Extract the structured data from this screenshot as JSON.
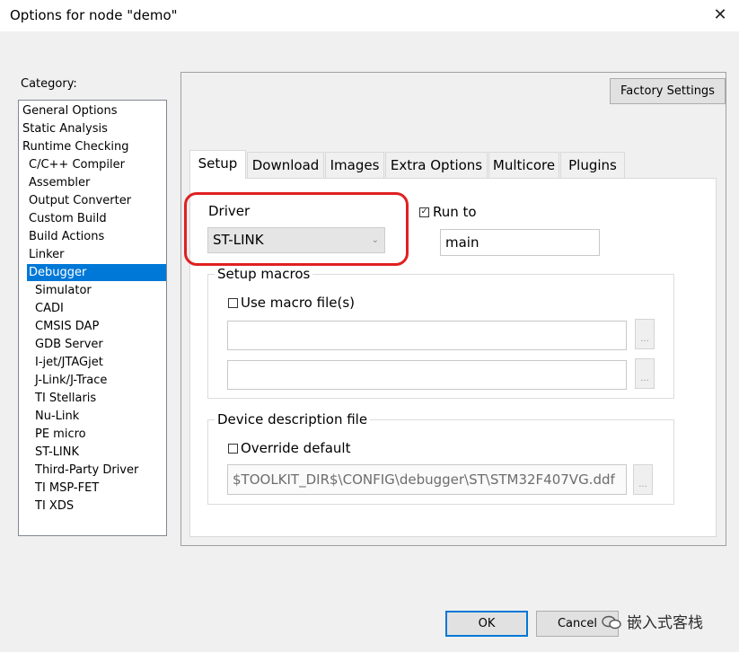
{
  "window": {
    "title": "Options for node \"demo\"",
    "close_glyph": "✕"
  },
  "category": {
    "label": "Category:",
    "items": [
      {
        "label": "General Options"
      },
      {
        "label": "Static Analysis"
      },
      {
        "label": "Runtime Checking"
      },
      {
        "label": "C/C++ Compiler"
      },
      {
        "label": "Assembler"
      },
      {
        "label": "Output Converter"
      },
      {
        "label": "Custom Build"
      },
      {
        "label": "Build Actions"
      },
      {
        "label": "Linker"
      },
      {
        "label": "Debugger",
        "selected": true
      },
      {
        "label": "Simulator"
      },
      {
        "label": "CADI"
      },
      {
        "label": "CMSIS DAP"
      },
      {
        "label": "GDB Server"
      },
      {
        "label": "I-jet/JTAGjet"
      },
      {
        "label": "J-Link/J-Trace"
      },
      {
        "label": "TI Stellaris"
      },
      {
        "label": "Nu-Link"
      },
      {
        "label": "PE micro"
      },
      {
        "label": "ST-LINK"
      },
      {
        "label": "Third-Party Driver"
      },
      {
        "label": "TI MSP-FET"
      },
      {
        "label": "TI XDS"
      }
    ]
  },
  "factory_settings_label": "Factory Settings",
  "tabs": [
    {
      "label": "Setup",
      "active": true
    },
    {
      "label": "Download"
    },
    {
      "label": "Images"
    },
    {
      "label": "Extra Options"
    },
    {
      "label": "Multicore"
    },
    {
      "label": "Plugins"
    }
  ],
  "setup": {
    "driver_label": "Driver",
    "driver_value": "ST-LINK",
    "run_to_label": "Run to",
    "run_to_checked": true,
    "run_to_value": "main",
    "setup_macros_title": "Setup macros",
    "use_macro_label": "Use macro file(s)",
    "use_macro_checked": false,
    "macro_file_1": "",
    "macro_file_2": "",
    "browse_label": "...",
    "device_desc_title": "Device description file",
    "override_label": "Override default",
    "override_checked": false,
    "device_desc_value": "$TOOLKIT_DIR$\\CONFIG\\debugger\\ST\\STM32F407VG.ddf"
  },
  "buttons": {
    "ok": "OK",
    "cancel": "Cancel"
  },
  "watermark": "嵌入式客栈",
  "colors": {
    "selection": "#0078d7",
    "highlight_box": "#e02020"
  }
}
